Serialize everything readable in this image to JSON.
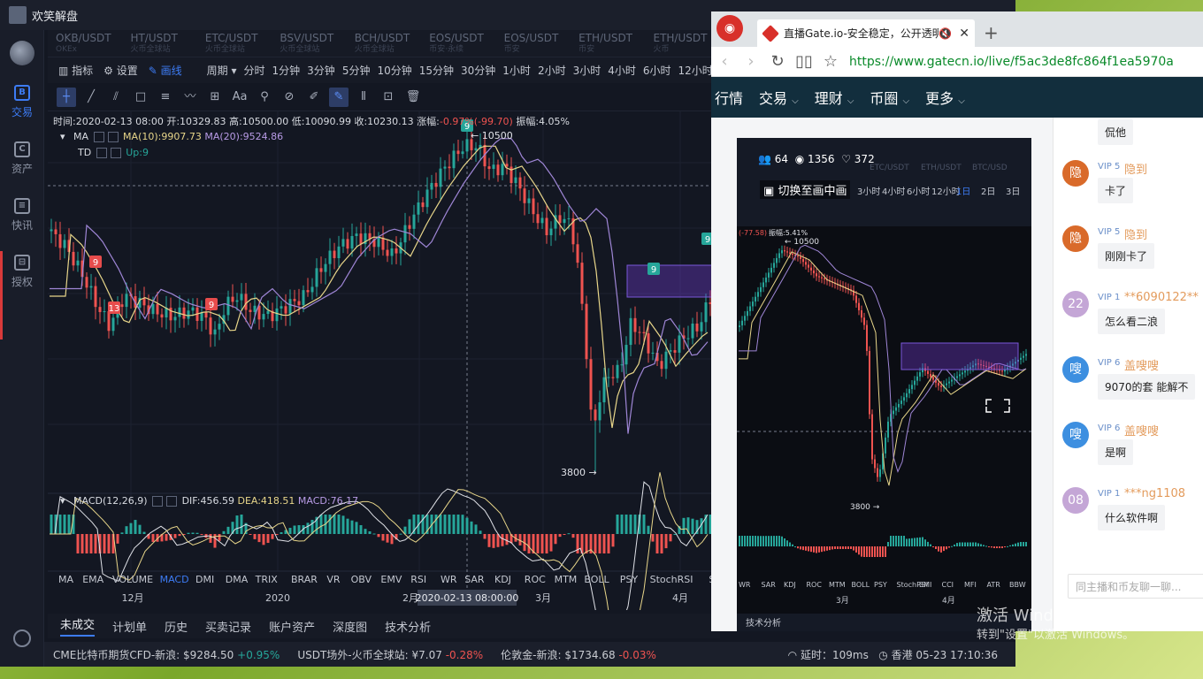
{
  "app": {
    "title": "欢笑解盘",
    "nav": [
      {
        "label": "交易",
        "glyph": "B"
      },
      {
        "label": "资产",
        "glyph": "C"
      },
      {
        "label": "快讯",
        "glyph": "≡"
      },
      {
        "label": "授权",
        "glyph": "⊟"
      }
    ],
    "pair_tabs": [
      {
        "pair": "OKB/USDT",
        "sub": "OKEx"
      },
      {
        "pair": "HT/USDT",
        "sub": "火币全球站"
      },
      {
        "pair": "ETC/USDT",
        "sub": "火币全球站"
      },
      {
        "pair": "BSV/USDT",
        "sub": "火币全球站"
      },
      {
        "pair": "BCH/USDT",
        "sub": "火币全球站"
      },
      {
        "pair": "EOS/USDT",
        "sub": "币安·永续"
      },
      {
        "pair": "EOS/USDT",
        "sub": "币安"
      },
      {
        "pair": "ETH/USDT",
        "sub": "币安"
      },
      {
        "pair": "ETH/USDT",
        "sub": "火币"
      }
    ],
    "toolbar": {
      "indicators": "指标",
      "settings": "设置",
      "draw": "画线",
      "period": "周期"
    },
    "periods": [
      "分时",
      "1分钟",
      "3分钟",
      "5分钟",
      "10分钟",
      "15分钟",
      "30分钟",
      "1小时",
      "2小时",
      "3小时",
      "4小时",
      "6小时",
      "12小时"
    ],
    "info_line": {
      "time": "时间:2020-02-13 08:00",
      "open": "开:10329.83",
      "high": "高:10500.00",
      "low": "低:10090.99",
      "close": "收:10230.13",
      "change_label": "涨幅:",
      "change": "-0.97%(-99.70)",
      "amplitude": "振幅:4.05%"
    },
    "ma": {
      "name": "MA",
      "ma10": "MA(10):9907.73",
      "ma20": "MA(20):9524.86"
    },
    "td": {
      "name": "TD",
      "up": "Up:9"
    },
    "macd": {
      "name": "MACD(12,26,9)",
      "dif": "DIF:456.59",
      "dea": "DEA:418.51",
      "macd": "MACD:76.17"
    },
    "price_labels": {
      "high": "← 10500",
      "low": "3800 →",
      "td13": "13",
      "td9": "9"
    },
    "indicator_tabs": [
      "MA",
      "EMA",
      "VOLUME",
      "MACD",
      "DMI",
      "DMA",
      "TRIX",
      "BRAR",
      "VR",
      "OBV",
      "EMV",
      "RSI",
      "WR",
      "SAR",
      "KDJ",
      "ROC",
      "MTM",
      "BOLL",
      "PSY",
      "StochRSI",
      "SMI",
      "CCI"
    ],
    "active_indicator": "MACD",
    "time_axis": [
      "12月",
      "2020",
      "2月",
      "3月",
      "4月"
    ],
    "crosshair_time": "2020-02-13 08:00:00",
    "bottom_tabs": [
      "未成交",
      "计划单",
      "历史",
      "买卖记录",
      "账户资产",
      "深度图",
      "技术分析"
    ],
    "ticker": [
      {
        "name": "CME比特币期货CFD-新浪:",
        "price": "$9284.50",
        "chg": "+0.95%",
        "up": true
      },
      {
        "name": "USDT场外-火币全球站:",
        "price": "¥7.07",
        "chg": "-0.28%",
        "up": false
      },
      {
        "name": "伦敦金-新浪:",
        "price": "$1734.68",
        "chg": "-0.03%",
        "up": false
      }
    ],
    "latency": "延时：109ms",
    "location_time": "香港 05-23 17:10:36"
  },
  "browser": {
    "tab_title": "直播Gate.io-安全稳定，公开透明",
    "url": "https://www.gatecn.io/live/f5ac3de8fc864f1ea5970a",
    "site_nav": [
      "行情",
      "交易",
      "理财",
      "币圈",
      "更多"
    ],
    "video": {
      "members": "64",
      "views": "1356",
      "likes": "372",
      "pip_label": "切换至画中画",
      "high": "10500",
      "low": "3800",
      "change": "振幅:5.41%",
      "change_left": "(-77.58)",
      "periods": [
        "3小时",
        "4小时",
        "6小时",
        "12小时",
        "1日",
        "2日",
        "3日"
      ],
      "pairs": [
        "ETC/USDT",
        "ETH/USDT",
        "BTC/USD"
      ],
      "tech_tab": "技术分析",
      "tabs": [
        "WR",
        "SAR",
        "KDJ",
        "ROC",
        "MTM",
        "BOLL",
        "PSY",
        "StochRSI",
        "SMI",
        "CCI",
        "MFI",
        "ATR",
        "BBW"
      ],
      "months": [
        "3月",
        "4月"
      ]
    },
    "chat": [
      {
        "avatar": "",
        "level": "",
        "name": "",
        "text": "侃他",
        "color": ""
      },
      {
        "avatar": "隐",
        "level": "VIP 5",
        "name": "隐到",
        "text": "卡了",
        "color": "#d96a2a"
      },
      {
        "avatar": "隐",
        "level": "VIP 5",
        "name": "隐到",
        "text": "刚刚卡了",
        "color": "#d96a2a"
      },
      {
        "avatar": "22",
        "level": "VIP 1",
        "name": "**6090122**",
        "text": "怎么看二浪",
        "color": "#c4a6d6"
      },
      {
        "avatar": "嗖",
        "level": "VIP 6",
        "name": "盖嗖嗖",
        "text": "9070的套 能解不",
        "color": "#3d8fe0"
      },
      {
        "avatar": "嗖",
        "level": "VIP 6",
        "name": "盖嗖嗖",
        "text": "是啊",
        "color": "#3d8fe0"
      },
      {
        "avatar": "08",
        "level": "VIP 1",
        "name": "***ng1108",
        "text": "什么软件啊",
        "color": "#c4a6d6"
      }
    ],
    "chat_placeholder": "同主播和币友聊一聊..."
  },
  "watermark": {
    "line1": "激活 Windows",
    "line2": "转到\"设置\"以激活 Windows。"
  }
}
